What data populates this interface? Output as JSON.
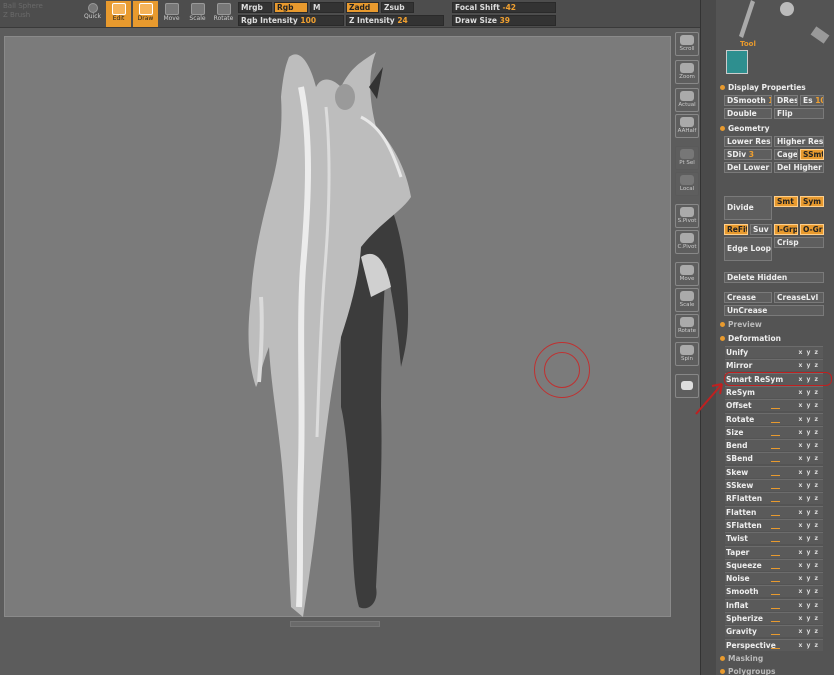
{
  "top": {
    "left_text": [
      "Ball Sphere",
      "Z Brush"
    ],
    "tools": [
      {
        "name": "quick",
        "label": "Quick"
      },
      {
        "name": "edit",
        "label": "Edit"
      },
      {
        "name": "draw",
        "label": "Draw"
      },
      {
        "name": "move",
        "label": "Move"
      },
      {
        "name": "scale",
        "label": "Scale"
      },
      {
        "name": "rotate",
        "label": "Rotate"
      }
    ],
    "mrgb": "Mrgb",
    "rgb": "Rgb",
    "m": "M",
    "zadd": "Zadd",
    "zsub": "Zsub",
    "rgb_intensity_label": "Rgb Intensity",
    "rgb_intensity_value": "100",
    "z_intensity_label": "Z Intensity",
    "z_intensity_value": "24",
    "focal_shift_label": "Focal Shift",
    "focal_shift_value": "-42",
    "draw_size_label": "Draw Size",
    "draw_size_value": "39"
  },
  "dock": [
    {
      "name": "scroll",
      "label": "Scroll"
    },
    {
      "name": "zoom",
      "label": "Zoom"
    },
    {
      "name": "actual",
      "label": "Actual"
    },
    {
      "name": "aahalf",
      "label": "AAHalf"
    },
    {
      "name": "ptsel",
      "label": "Pt Sel"
    },
    {
      "name": "local",
      "label": "Local"
    },
    {
      "name": "spivot",
      "label": "S.Pivot"
    },
    {
      "name": "cpivot",
      "label": "C.Pivot"
    },
    {
      "name": "move",
      "label": "Move"
    },
    {
      "name": "scale",
      "label": "Scale"
    },
    {
      "name": "rotate",
      "label": "Rotate"
    },
    {
      "name": "spin",
      "label": "Spin"
    }
  ],
  "panel": {
    "tool_label": "Tool",
    "display_properties": "Display Properties",
    "dsmooth": "DSmooth",
    "dsmooth_val": "1",
    "dres": "DRes",
    "es": "Es",
    "es_val": "10",
    "double": "Double",
    "flip": "Flip",
    "geometry": "Geometry",
    "lower_res": "Lower Res",
    "higher_res": "Higher Res",
    "sdiv": "SDiv",
    "sdiv_val": "3",
    "cage": "Cage",
    "ssmt": "SSmt",
    "del_lower": "Del Lower",
    "del_higher": "Del Higher",
    "divide": "Divide",
    "smt": "Smt",
    "sym": "Sym",
    "refit": "ReFit",
    "suv": "Suv",
    "igrp": "I-Grp",
    "ogrp": "O-Grp",
    "edge_loop": "Edge Loop",
    "crisp": "Crisp",
    "delete_hidden": "Delete Hidden",
    "crease": "Crease",
    "creaselvl": "CreaseLvl",
    "uncrease": "UnCrease",
    "preview": "Preview",
    "deformation": "Deformation",
    "deformers": [
      {
        "name": "unify",
        "label": "Unify",
        "xyz": "x y z"
      },
      {
        "name": "mirror",
        "label": "Mirror",
        "xyz": "x y z"
      },
      {
        "name": "smart-resym",
        "label": "Smart ReSym",
        "xyz": "x y z"
      },
      {
        "name": "resym",
        "label": "ReSym",
        "xyz": "x y z"
      },
      {
        "name": "offset",
        "label": "Offset",
        "xyz": "x y z"
      },
      {
        "name": "rotate",
        "label": "Rotate",
        "xyz": "x y z"
      },
      {
        "name": "size",
        "label": "Size",
        "xyz": "x y z"
      },
      {
        "name": "bend",
        "label": "Bend",
        "xyz": "x y z"
      },
      {
        "name": "sbend",
        "label": "SBend",
        "xyz": "x y z"
      },
      {
        "name": "skew",
        "label": "Skew",
        "xyz": "x y z"
      },
      {
        "name": "sskew",
        "label": "SSkew",
        "xyz": "x y z"
      },
      {
        "name": "rflatten",
        "label": "RFlatten",
        "xyz": "x y z"
      },
      {
        "name": "flatten",
        "label": "Flatten",
        "xyz": "x y z"
      },
      {
        "name": "sflatten",
        "label": "SFlatten",
        "xyz": "x y z"
      },
      {
        "name": "twist",
        "label": "Twist",
        "xyz": "x y z"
      },
      {
        "name": "taper",
        "label": "Taper",
        "xyz": "x y z"
      },
      {
        "name": "squeeze",
        "label": "Squeeze",
        "xyz": "x y z"
      },
      {
        "name": "noise",
        "label": "Noise",
        "xyz": "x y z"
      },
      {
        "name": "smooth",
        "label": "Smooth",
        "xyz": "x y z"
      },
      {
        "name": "inflat",
        "label": "Inflat",
        "xyz": "x y z"
      },
      {
        "name": "spherize",
        "label": "Spherize",
        "xyz": "x y z"
      },
      {
        "name": "gravity",
        "label": "Gravity",
        "xyz": "x y z"
      },
      {
        "name": "perspective",
        "label": "Perspective",
        "xyz": "x y z"
      }
    ],
    "masking": "Masking",
    "polygroups": "Polygroups"
  },
  "colors": {
    "accent": "#e89a2e",
    "annotation": "#c02020"
  }
}
